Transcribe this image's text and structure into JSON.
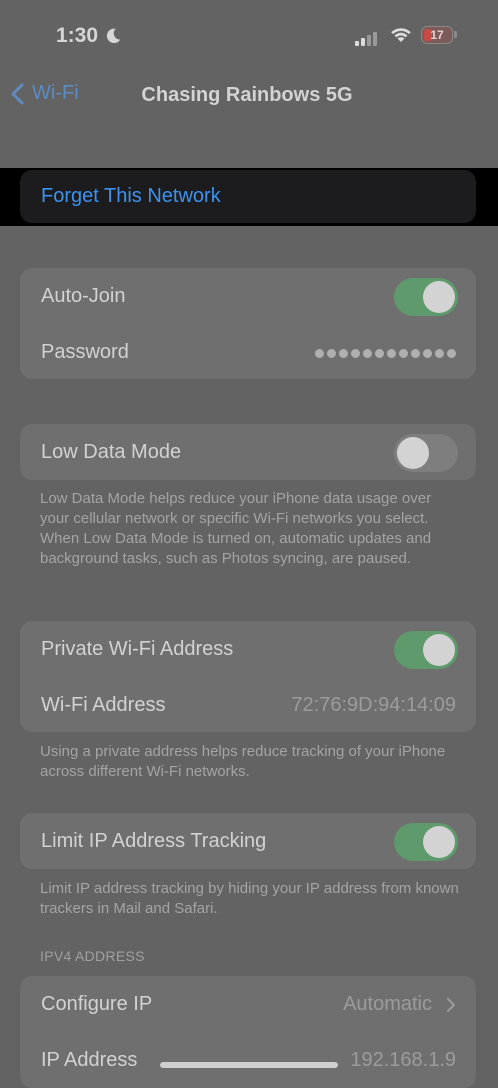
{
  "status_bar": {
    "time": "1:30",
    "battery": "17",
    "battery_color": "#c74a44"
  },
  "nav": {
    "back_label": "Wi-Fi",
    "title": "Chasing Rainbows 5G"
  },
  "forget": {
    "label": "Forget This Network"
  },
  "group1": {
    "auto_join_label": "Auto-Join",
    "auto_join_on": true,
    "password_label": "Password"
  },
  "group2": {
    "low_data_label": "Low Data Mode",
    "low_data_on": false,
    "footnote": "Low Data Mode helps reduce your iPhone data usage over your cellular network or specific Wi-Fi networks you select. When Low Data Mode is turned on, automatic updates and background tasks, such as Photos syncing, are paused."
  },
  "group3": {
    "private_label": "Private Wi-Fi Address",
    "private_on": true,
    "address_label": "Wi-Fi Address",
    "address_value": "72:76:9D:94:14:09",
    "footnote": "Using a private address helps reduce tracking of your iPhone across different Wi-Fi networks."
  },
  "group4": {
    "limit_label": "Limit IP Address Tracking",
    "limit_on": true,
    "footnote": "Limit IP address tracking by hiding your IP address from known trackers in Mail and Safari."
  },
  "ipv4": {
    "header": "IPV4 ADDRESS",
    "configure_label": "Configure IP",
    "configure_value": "Automatic",
    "ip_label": "IP Address",
    "ip_value": "192.168.1.9"
  },
  "colors": {
    "accent": "#3b93f0",
    "toggle_on": "#5f9a6c"
  }
}
